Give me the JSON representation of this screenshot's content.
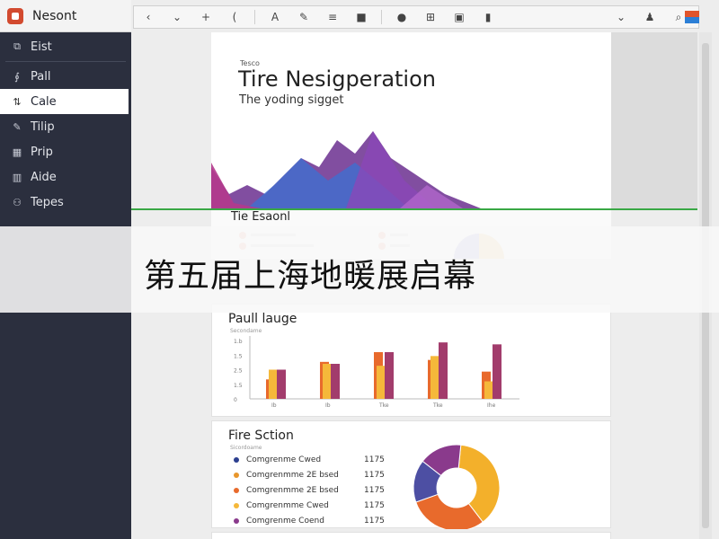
{
  "app": {
    "name": "Nesont"
  },
  "sidebar": {
    "items": [
      {
        "label": "Eist",
        "icon": "copy-icon",
        "glyph": "⧉"
      },
      {
        "label": "Pall",
        "icon": "link-icon",
        "glyph": "∮"
      },
      {
        "label": "Cale",
        "icon": "ruler-icon",
        "glyph": "⇅",
        "active": true
      },
      {
        "label": "Tilip",
        "icon": "pen-icon",
        "glyph": "✎"
      },
      {
        "label": "Prip",
        "icon": "grid-icon",
        "glyph": "▦"
      },
      {
        "label": "Aide",
        "icon": "book-icon",
        "glyph": "▥"
      },
      {
        "label": "Tepes",
        "icon": "tags-icon",
        "glyph": "⚇"
      }
    ]
  },
  "toolbar": {
    "buttons": [
      {
        "name": "back-icon",
        "glyph": "‹"
      },
      {
        "name": "chevron-down-icon",
        "glyph": "⌄"
      },
      {
        "name": "plus-icon",
        "glyph": "+"
      },
      {
        "name": "brace-icon",
        "glyph": "("
      },
      {
        "name": "text-icon",
        "glyph": "A"
      },
      {
        "name": "pen-icon",
        "glyph": "✎"
      },
      {
        "name": "list-icon",
        "glyph": "≡"
      },
      {
        "name": "image-icon",
        "glyph": "■"
      },
      {
        "name": "record-icon",
        "glyph": "●"
      },
      {
        "name": "table-icon",
        "glyph": "⊞"
      },
      {
        "name": "frame-icon",
        "glyph": "▣"
      },
      {
        "name": "bar-icon",
        "glyph": "▮"
      }
    ],
    "right": [
      {
        "name": "chevron-down-icon",
        "glyph": "⌄"
      },
      {
        "name": "user-icon",
        "glyph": "♟"
      },
      {
        "name": "search-icon",
        "glyph": "⌕"
      }
    ]
  },
  "hero": {
    "eyebrow": "Tesco",
    "title": "Tire Nesigperation",
    "subtitle": "The yoding sigget"
  },
  "section_one": {
    "title": "Tie Esaonl"
  },
  "banner": {
    "text": "第五届上海地暖展启幕"
  },
  "bar_card": {
    "title": "Paull lauge",
    "subtitle": "Secondame"
  },
  "chart_data": [
    {
      "type": "bar",
      "title": "Paull lauge",
      "categories": [
        "Ib",
        "Ib",
        "Tke",
        "Tke",
        "Ihe"
      ],
      "series": [
        {
          "values": [
            1.0,
            1.9,
            2.4,
            2.0,
            1.4
          ],
          "color": "#e86a2c"
        },
        {
          "values": [
            1.5,
            1.8,
            1.7,
            2.2,
            0.9
          ],
          "color": "#f5b83a"
        },
        {
          "values": [
            1.5,
            1.8,
            2.4,
            2.9,
            2.8
          ],
          "color": "#a23c6c"
        }
      ],
      "yticks": [
        "1.b",
        "1.5",
        "2.5",
        "1.5",
        "0"
      ],
      "ylim": [
        0,
        3
      ]
    },
    {
      "type": "pie",
      "title": "Fire Sction",
      "values": [
        38,
        30,
        16,
        16
      ],
      "colors": [
        "#f3b02b",
        "#e86a2c",
        "#4d4fa3",
        "#8a3a8c"
      ]
    }
  ],
  "fire_card": {
    "title": "Fire Sction",
    "subtitle": "Sicordoame",
    "rows": [
      {
        "label": "Comgrenme Cwed",
        "value": "1175",
        "color": "#2c3f8f"
      },
      {
        "label": "Comgrenmme 2E bsed",
        "value": "1175",
        "color": "#e8962c"
      },
      {
        "label": "Comgrenmme 2E bsed",
        "value": "1175",
        "color": "#e86a2c"
      },
      {
        "label": "Comgrenmme Cwed",
        "value": "1175",
        "color": "#f5b83a"
      },
      {
        "label": "Comgrenme Coend",
        "value": "1175",
        "color": "#8a3a8c"
      }
    ]
  }
}
